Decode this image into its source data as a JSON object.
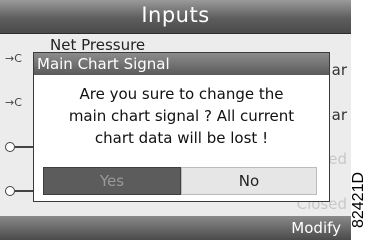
{
  "header": {
    "title": "Inputs"
  },
  "background": {
    "row1": {
      "label": "Net Pressure",
      "icon": "→C",
      "right": "ar"
    },
    "row2": {
      "icon": "→C",
      "right": "ar"
    },
    "row3": {
      "right": "ed"
    },
    "row4": {
      "right": "Closed"
    }
  },
  "dialog": {
    "title": "Main Chart Signal",
    "message_lines": [
      "Are you sure to change the",
      "main chart signal ? All current",
      "chart data will be lost !"
    ],
    "yes_label": "Yes",
    "no_label": "No"
  },
  "footer": {
    "modify_label": "Modify"
  },
  "reference_code": "82421D",
  "colors": {
    "title_bar": "#5e5e5e",
    "dialog_header": "#6a6a6a",
    "yes_button": "#5c5c5c",
    "no_button": "#e6e6e6"
  }
}
